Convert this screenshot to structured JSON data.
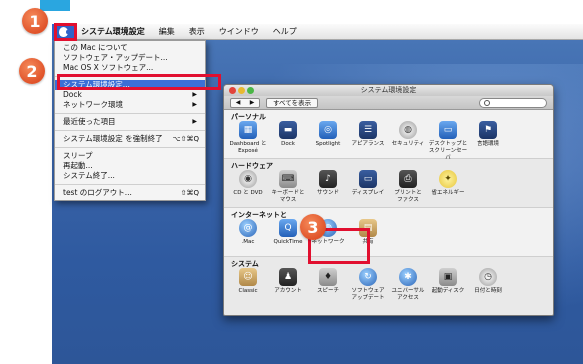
{
  "menubar": {
    "items": [
      "システム環境設定",
      "編集",
      "表示",
      "ウインドウ",
      "ヘルプ"
    ]
  },
  "apple_menu": {
    "items": [
      "この Mac について",
      "ソフトウェア・アップデート...",
      "Mac OS X ソフトウェア...",
      "システム環境設定...",
      "Dock",
      "ネットワーク環境",
      "最近使った項目",
      "システム環境設定 を強制終了",
      "スリープ",
      "再起動...",
      "システム終了...",
      "test のログアウト..."
    ],
    "shortcuts": {
      "force_quit": "⌥⇧⌘Q",
      "logout": "⇧⌘Q"
    }
  },
  "badges": [
    "1",
    "2",
    "3"
  ],
  "window": {
    "title": "システム環境設定",
    "nav": [
      "◀",
      "▶"
    ],
    "show_all": "すべてを表示",
    "sections": [
      {
        "title": "パーソナル",
        "items": [
          {
            "label": "Dashboard と\nExposé",
            "icon": "dashboard-icon"
          },
          {
            "label": "Dock",
            "icon": "dock-icon"
          },
          {
            "label": "Spotlight",
            "icon": "spotlight-icon"
          },
          {
            "label": "アピアランス",
            "icon": "appearance-icon"
          },
          {
            "label": "セキュリティ",
            "icon": "security-icon"
          },
          {
            "label": "デスクトップと\nスクリーンセーバ",
            "icon": "desktop-icon"
          },
          {
            "label": "言語環境",
            "icon": "international-icon"
          }
        ]
      },
      {
        "title": "ハードウェア",
        "items": [
          {
            "label": "CD と DVD",
            "icon": "cd-icon"
          },
          {
            "label": "キーボードと\nマウス",
            "icon": "keyboard-mouse-icon"
          },
          {
            "label": "サウンド",
            "icon": "sound-icon"
          },
          {
            "label": "ディスプレイ",
            "icon": "display-icon"
          },
          {
            "label": "プリントと\nファクス",
            "icon": "print-icon"
          },
          {
            "label": "省エネルギー",
            "icon": "energy-saver-icon"
          }
        ]
      },
      {
        "title": "インターネットと",
        "items": [
          {
            "label": ".Mac",
            "icon": "mac-icon"
          },
          {
            "label": "QuickTime",
            "icon": "quicktime-icon"
          },
          {
            "label": "ネットワーク",
            "icon": "network-icon"
          },
          {
            "label": "共有",
            "icon": "sharing-icon"
          }
        ]
      },
      {
        "title": "システム",
        "items": [
          {
            "label": "Classic",
            "icon": "classic-icon"
          },
          {
            "label": "アカウント",
            "icon": "accounts-icon"
          },
          {
            "label": "スピーチ",
            "icon": "speech-icon"
          },
          {
            "label": "ソフトウェア\nアップデート",
            "icon": "software-update-icon"
          },
          {
            "label": "ユニバーサル\nアクセス",
            "icon": "universal-access-icon"
          },
          {
            "label": "起動ディスク",
            "icon": "startup-disk-icon"
          },
          {
            "label": "日付と時刻",
            "icon": "date-time-icon"
          }
        ]
      }
    ]
  }
}
